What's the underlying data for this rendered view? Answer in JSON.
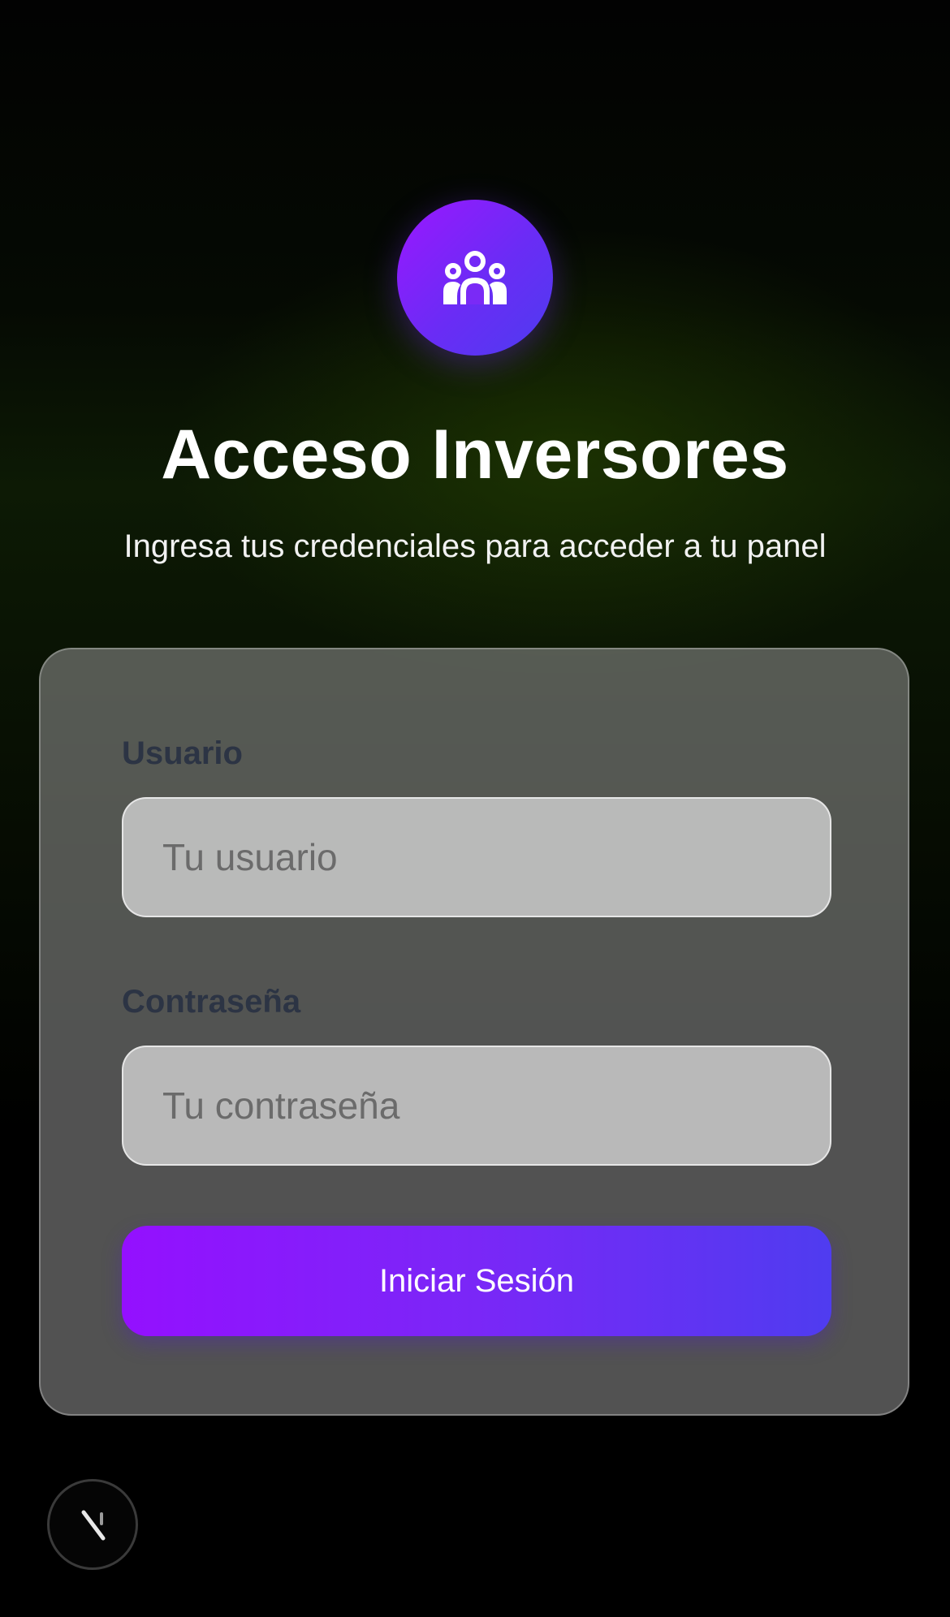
{
  "header": {
    "logo_icon": "users-group-icon",
    "title": "Acceso Inversores",
    "subtitle": "Ingresa tus credenciales para acceder a tu panel"
  },
  "form": {
    "username": {
      "label": "Usuario",
      "placeholder": "Tu usuario",
      "value": ""
    },
    "password": {
      "label": "Contraseña",
      "placeholder": "Tu contraseña",
      "value": ""
    },
    "submit_label": "Iniciar Sesión"
  },
  "corner_badge": {
    "icon": "n-logo-icon"
  },
  "colors": {
    "accent_start": "#9410ff",
    "accent_end": "#4f3cf0",
    "label_text": "#2c3444",
    "car_green": "#7ed321"
  }
}
